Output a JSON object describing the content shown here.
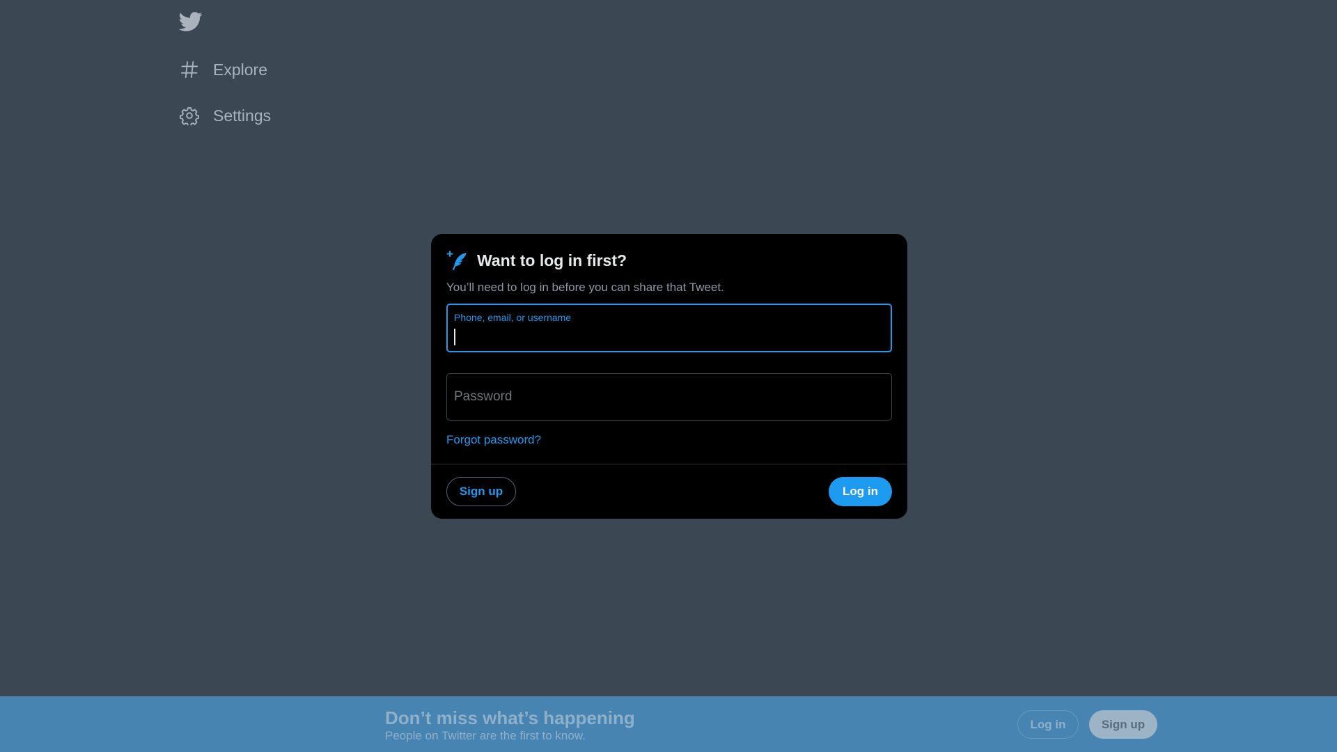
{
  "sidebar": {
    "logo_icon": "twitter-bird-icon",
    "items": [
      {
        "label": "Explore",
        "icon": "hashtag-icon"
      },
      {
        "label": "Settings",
        "icon": "gear-icon"
      }
    ]
  },
  "modal": {
    "icon": "quill-sparkle-icon",
    "title": "Want to log in first?",
    "subtitle": "You’ll need to log in before you can share that Tweet.",
    "username_label": "Phone, email, or username",
    "username_value": "",
    "password_placeholder": "Password",
    "forgot_password": "Forgot password?",
    "signup_label": "Sign up",
    "login_label": "Log in"
  },
  "banner": {
    "title": "Don’t miss what’s happening",
    "subtitle": "People on Twitter are the first to know.",
    "login_label": "Log in",
    "signup_label": "Sign up"
  },
  "colors": {
    "accent": "#1d9bf0",
    "backdrop": "#3b4854",
    "modal_bg": "#000000",
    "banner_bg": "#4784b2"
  }
}
